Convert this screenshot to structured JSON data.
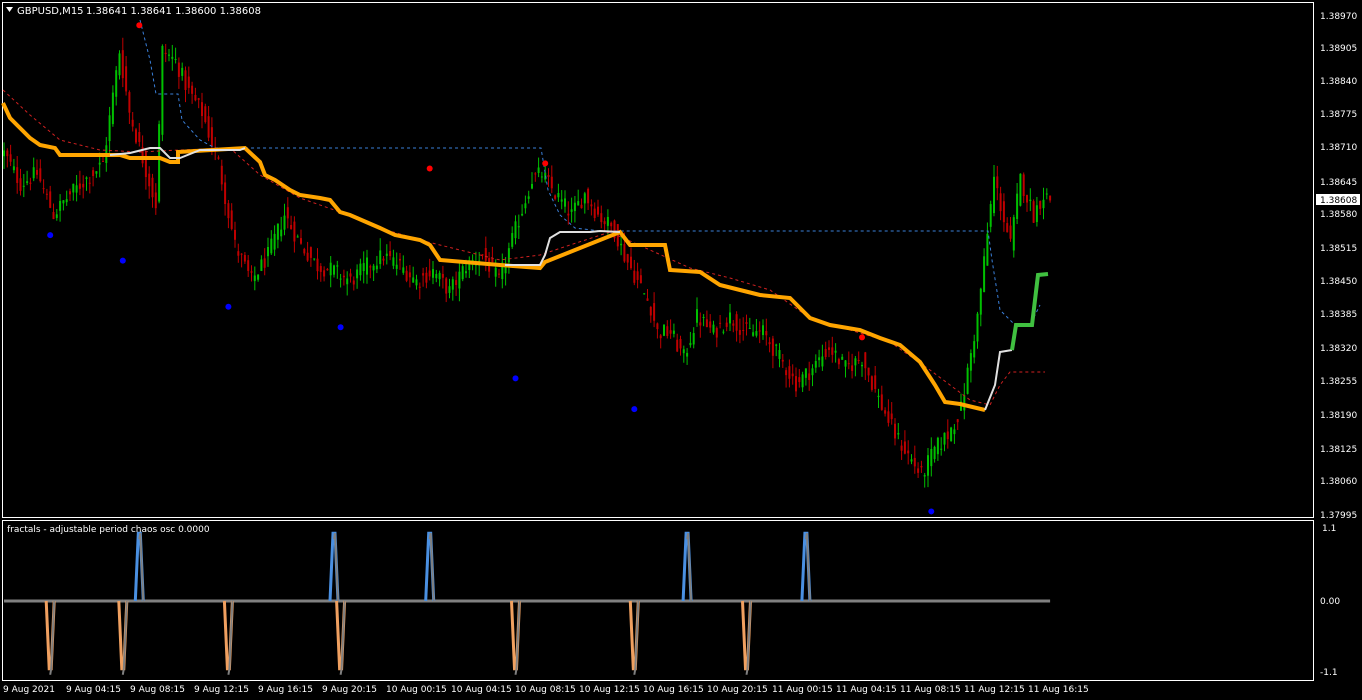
{
  "header": {
    "symbol": "GBPUSD,M15",
    "ohlc": "1.38641 1.38641 1.38600 1.38608"
  },
  "price_axis": {
    "labels": [
      "1.38970",
      "1.38905",
      "1.38840",
      "1.38775",
      "1.38710",
      "1.38645",
      "1.38580",
      "1.38515",
      "1.38450",
      "1.38385",
      "1.38320",
      "1.38255",
      "1.38190",
      "1.38125",
      "1.38060",
      "1.37995"
    ],
    "current_price": "1.38608"
  },
  "oscillator": {
    "title": "fractals - adjustable period chaos osc 0.0000",
    "labels": [
      "1.1",
      "0.00",
      "-1.1"
    ]
  },
  "time_axis": {
    "labels": [
      "9 Aug 2021",
      "9 Aug 04:15",
      "9 Aug 08:15",
      "9 Aug 12:15",
      "9 Aug 16:15",
      "9 Aug 20:15",
      "10 Aug 00:15",
      "10 Aug 04:15",
      "10 Aug 08:15",
      "10 Aug 12:15",
      "10 Aug 16:15",
      "10 Aug 20:15",
      "11 Aug 00:15",
      "11 Aug 04:15",
      "11 Aug 08:15",
      "11 Aug 12:15",
      "11 Aug 16:15"
    ]
  },
  "colors": {
    "background": "#000000",
    "bull_candle": "#00c000",
    "bear_candle": "#c00000",
    "fractal_up": "#ff0000",
    "fractal_down": "#0000ff",
    "ma_line": "#ffa500",
    "osc_up": "#4a90e2",
    "osc_down": "#f0a060",
    "osc_neutral": "#808080"
  },
  "chart_data": {
    "type": "candlestick",
    "symbol": "GBPUSD",
    "timeframe": "M15",
    "ylim": [
      1.37995,
      1.3897
    ],
    "close_path": [
      [
        0,
        1.387
      ],
      [
        5,
        1.3864
      ],
      [
        10,
        1.3866
      ],
      [
        15,
        1.3858
      ],
      [
        20,
        1.3862
      ],
      [
        25,
        1.3865
      ],
      [
        30,
        1.3868
      ],
      [
        35,
        1.389
      ],
      [
        38,
        1.3878
      ],
      [
        42,
        1.3869
      ],
      [
        46,
        1.386
      ],
      [
        48,
        1.389
      ],
      [
        52,
        1.3888
      ],
      [
        56,
        1.3882
      ],
      [
        60,
        1.3878
      ],
      [
        65,
        1.3868
      ],
      [
        70,
        1.3852
      ],
      [
        75,
        1.3845
      ],
      [
        80,
        1.385
      ],
      [
        85,
        1.3858
      ],
      [
        90,
        1.3852
      ],
      [
        95,
        1.3848
      ],
      [
        100,
        1.3847
      ],
      [
        105,
        1.3845
      ],
      [
        110,
        1.3848
      ],
      [
        115,
        1.385
      ],
      [
        120,
        1.3848
      ],
      [
        125,
        1.3845
      ],
      [
        130,
        1.3847
      ],
      [
        135,
        1.3843
      ],
      [
        140,
        1.3848
      ],
      [
        145,
        1.385
      ],
      [
        150,
        1.3845
      ],
      [
        155,
        1.3855
      ],
      [
        160,
        1.3865
      ],
      [
        163,
        1.3866
      ],
      [
        167,
        1.3862
      ],
      [
        172,
        1.3858
      ],
      [
        176,
        1.3862
      ],
      [
        180,
        1.3858
      ],
      [
        185,
        1.3855
      ],
      [
        188,
        1.385
      ],
      [
        192,
        1.3845
      ],
      [
        196,
        1.384
      ],
      [
        198,
        1.3835
      ],
      [
        202,
        1.3835
      ],
      [
        206,
        1.383
      ],
      [
        210,
        1.3838
      ],
      [
        215,
        1.3835
      ],
      [
        220,
        1.3838
      ],
      [
        225,
        1.3835
      ],
      [
        230,
        1.3835
      ],
      [
        235,
        1.383
      ],
      [
        240,
        1.3825
      ],
      [
        245,
        1.3828
      ],
      [
        250,
        1.3832
      ],
      [
        255,
        1.3828
      ],
      [
        260,
        1.383
      ],
      [
        265,
        1.3822
      ],
      [
        270,
        1.3815
      ],
      [
        275,
        1.381
      ],
      [
        278,
        1.3807
      ],
      [
        282,
        1.3812
      ],
      [
        286,
        1.3815
      ],
      [
        290,
        1.382
      ],
      [
        295,
        1.3838
      ],
      [
        300,
        1.3865
      ],
      [
        305,
        1.3852
      ],
      [
        308,
        1.3865
      ],
      [
        312,
        1.3858
      ],
      [
        315,
        1.3862
      ],
      [
        317,
        1.3861
      ]
    ],
    "fractal_up": [
      [
        41,
        1.3895
      ],
      [
        129,
        1.3867
      ],
      [
        164,
        1.3868
      ],
      [
        260,
        1.3834
      ]
    ],
    "fractal_down": [
      [
        14,
        1.3854
      ],
      [
        36,
        1.3849
      ],
      [
        68,
        1.384
      ],
      [
        102,
        1.3836
      ],
      [
        155,
        1.3826
      ],
      [
        191,
        1.382
      ],
      [
        281,
        1.38
      ]
    ],
    "oscillator": {
      "range": [
        -1.1,
        1.1
      ],
      "up_spikes": [
        41,
        100,
        129,
        207,
        243
      ],
      "down_spikes": [
        14,
        36,
        68,
        102,
        155,
        191,
        225
      ]
    }
  }
}
